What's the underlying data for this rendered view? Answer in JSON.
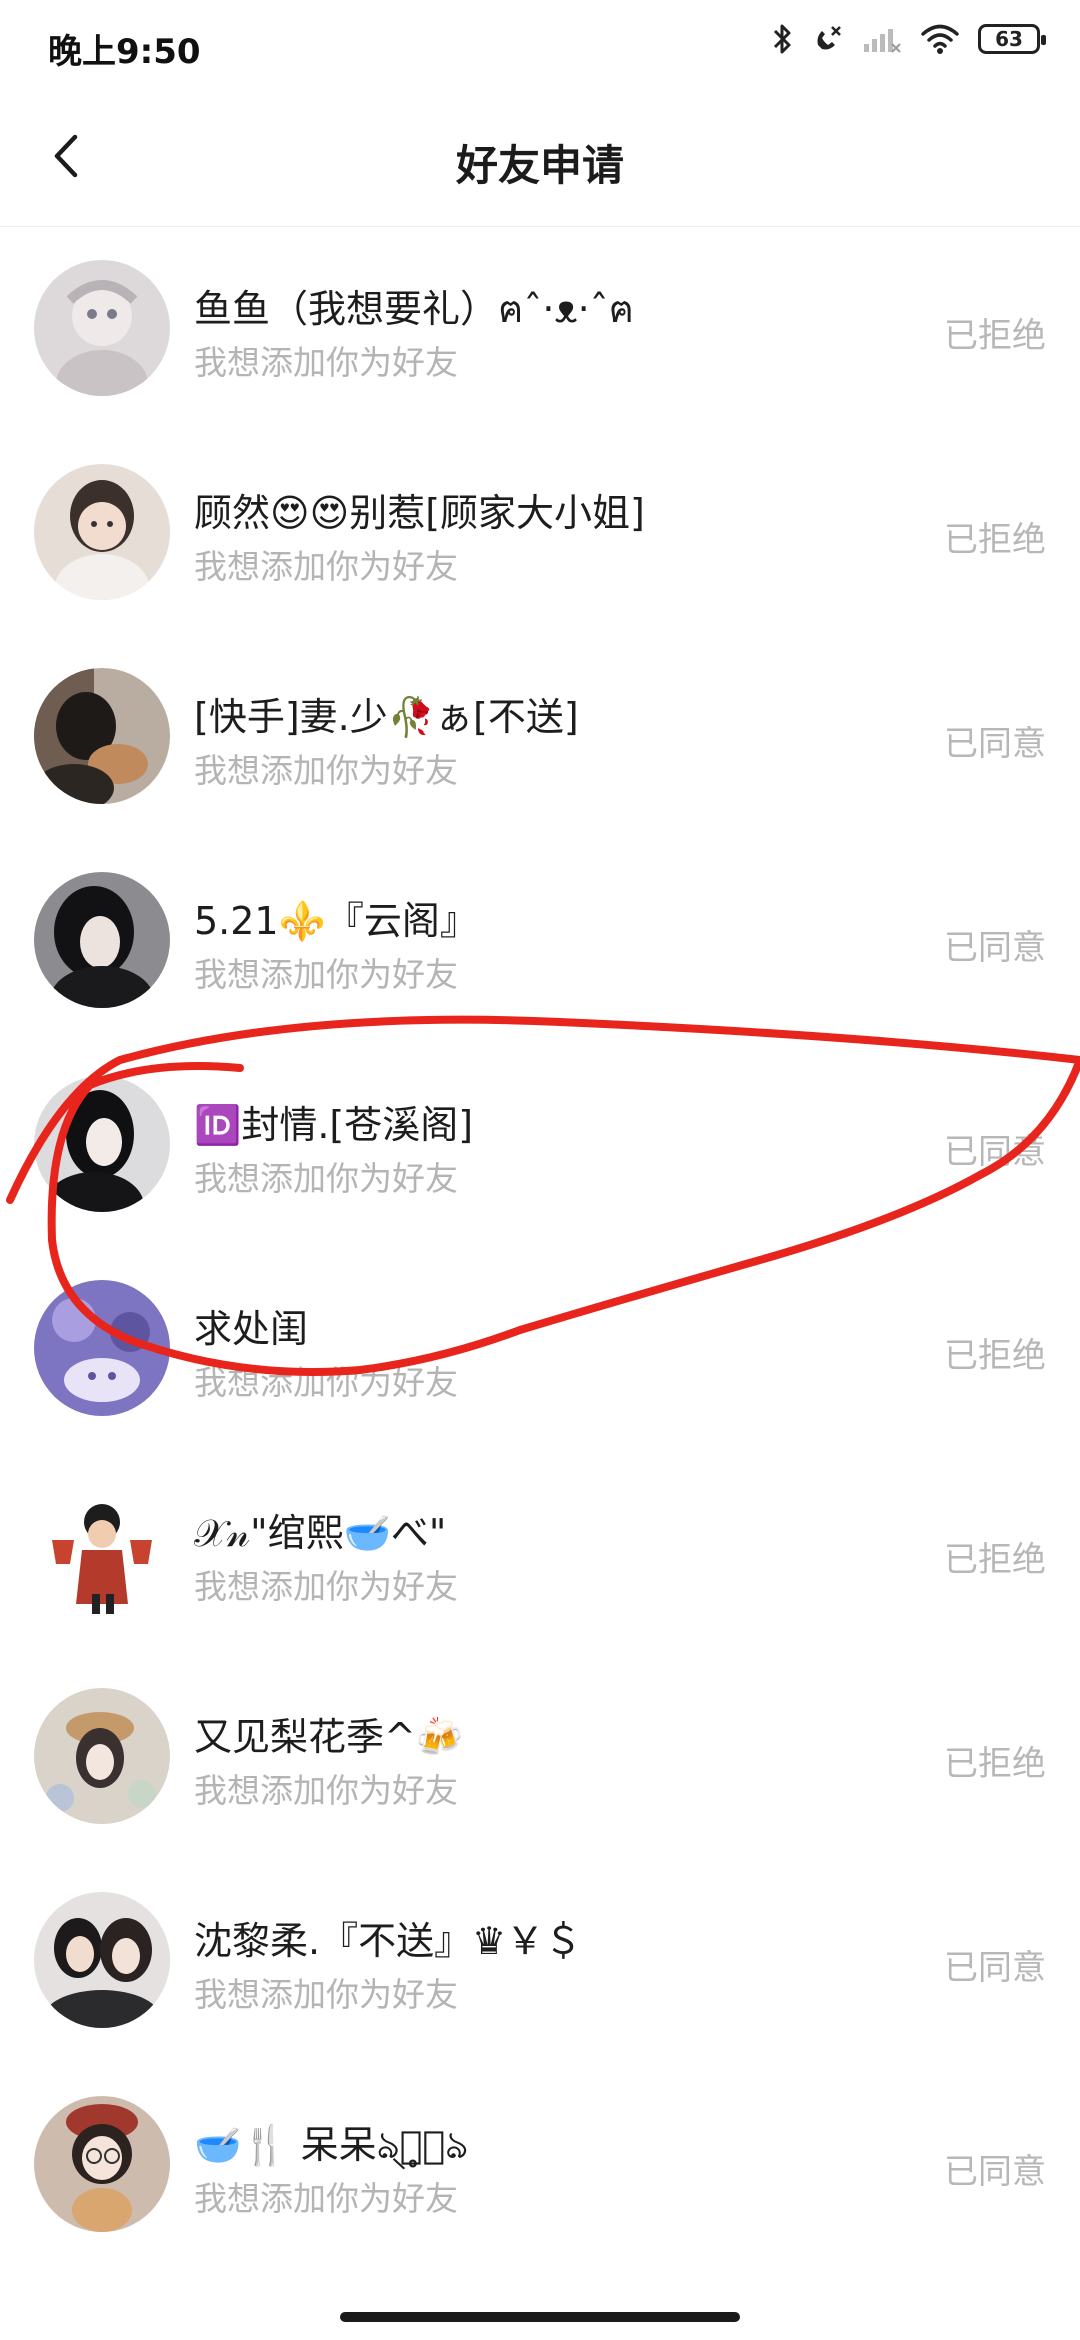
{
  "status_bar": {
    "time": "晚上9:50",
    "battery": "63"
  },
  "header": {
    "title": "好友申请"
  },
  "requests": [
    {
      "name": "鱼鱼（我想要礼）ฅˆ·ᴥ·ˆฅ",
      "message": "我想添加你为好友",
      "status": "已拒绝",
      "avatar_color": "#d9d4d6"
    },
    {
      "name": "顾然😍😍别惹[顾家大小姐]",
      "message": "我想添加你为好友",
      "status": "已拒绝",
      "avatar_color": "#c9b4a8"
    },
    {
      "name": "[快手]妻.少🥀ぁ[不送]",
      "message": "我想添加你为好友",
      "status": "已同意",
      "avatar_color": "#8a7462"
    },
    {
      "name": "5.21⚜️『云阁』",
      "message": "我想添加你为好友",
      "status": "已同意",
      "avatar_color": "#4a4a4e"
    },
    {
      "name": "🆔封情.[苍溪阁]",
      "message": "我想添加你为好友",
      "status": "已同意",
      "avatar_color": "#3a3a3d"
    },
    {
      "name": "求处闺",
      "message": "我想添加你为好友",
      "status": "已拒绝",
      "avatar_color": "#8f86c9"
    },
    {
      "name": "𝒳𝓃\"绾熙🥣べ\"",
      "message": "我想添加你为好友",
      "status": "已拒绝",
      "avatar_color": "#b43a2c"
    },
    {
      "name": "又见梨花季^🍻",
      "message": "我想添加你为好友",
      "status": "已拒绝",
      "avatar_color": "#c9c2b8"
    },
    {
      "name": "沈黎柔.『不送』♛￥＄",
      "message": "我想添加你为好友",
      "status": "已同意",
      "avatar_color": "#5d5857"
    },
    {
      "name": "🥣🍴 呆呆ঌ্ᩚ̥⃝ঌ",
      "message": "我想添加你为好友",
      "status": "已同意",
      "avatar_color": "#b89a84"
    }
  ],
  "colors": {
    "annotation_stroke": "#e8251c",
    "status_text": "#b7b7b7",
    "message_text": "#b4b4b4"
  }
}
